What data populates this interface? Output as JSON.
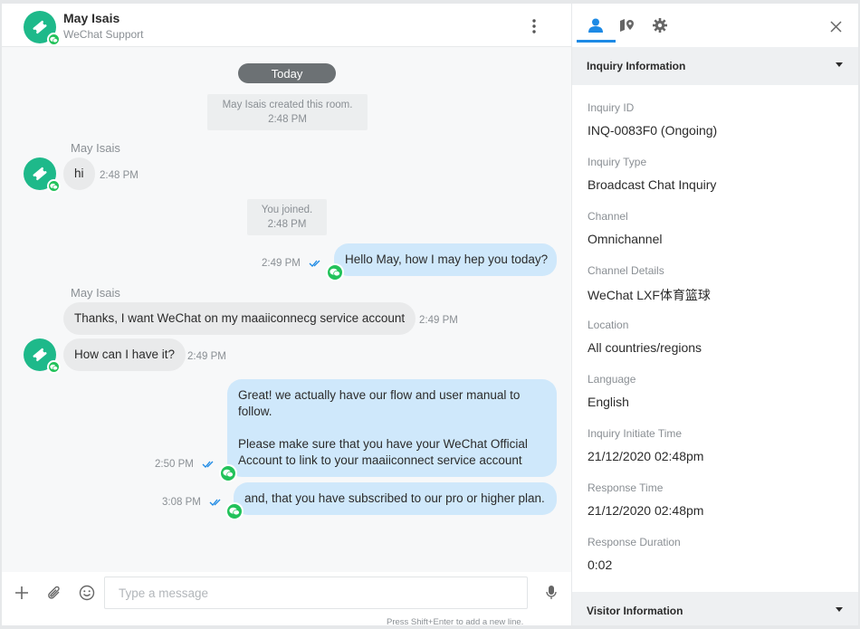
{
  "header": {
    "name": "May Isais",
    "subtitle": "WeChat Support"
  },
  "messages": {
    "today": "Today",
    "created_room": "May Isais created this room.",
    "created_time": "2:48 PM",
    "msg1_sender": "May Isais",
    "msg1_text": "hi",
    "msg1_time": "2:48 PM",
    "joined": "You joined.",
    "joined_time": "2:48 PM",
    "msg2_time": "2:49 PM",
    "msg2_text": "Hello May, how I may hep you today?",
    "msg3_sender": "May Isais",
    "msg3_text": "Thanks, I want WeChat on my maaiiconnecg service account",
    "msg3_time": "2:49 PM",
    "msg4_text": "How can I have it?",
    "msg4_time": "2:49 PM",
    "msg5_line1": "Great! we actually have our flow and user manual to follow.",
    "msg5_line2": "Please make sure that you have your WeChat Official Account to link to your maaiiconnect service account",
    "msg5_time": "2:50 PM",
    "msg6_text": "and, that you have subscribed to our pro or higher plan.",
    "msg6_time": "3:08 PM"
  },
  "composer": {
    "placeholder": "Type a message",
    "hint": "Press Shift+Enter to add a new line."
  },
  "side": {
    "section1": "Inquiry Information",
    "section2": "Visitor Information",
    "fields": [
      {
        "label": "Inquiry ID",
        "value": "INQ-0083F0 (Ongoing)"
      },
      {
        "label": "Inquiry Type",
        "value": "Broadcast Chat Inquiry"
      },
      {
        "label": "Channel",
        "value": "Omnichannel"
      },
      {
        "label": "Channel Details",
        "value": "WeChat LXF体育篮球"
      },
      {
        "label": "Location",
        "value": "All countries/regions"
      },
      {
        "label": "Language",
        "value": "English"
      },
      {
        "label": "Inquiry Initiate Time",
        "value": "21/12/2020 02:48pm"
      },
      {
        "label": "Response Time",
        "value": "21/12/2020 02:48pm"
      },
      {
        "label": "Response Duration",
        "value": "0:02"
      }
    ]
  },
  "colors": {
    "accent": "#1d8ae5",
    "avatar": "#1eb98a",
    "wechat": "#22c25a",
    "outgoing_bubble": "#cfe8fb",
    "incoming_bubble": "#e9eaeb"
  }
}
